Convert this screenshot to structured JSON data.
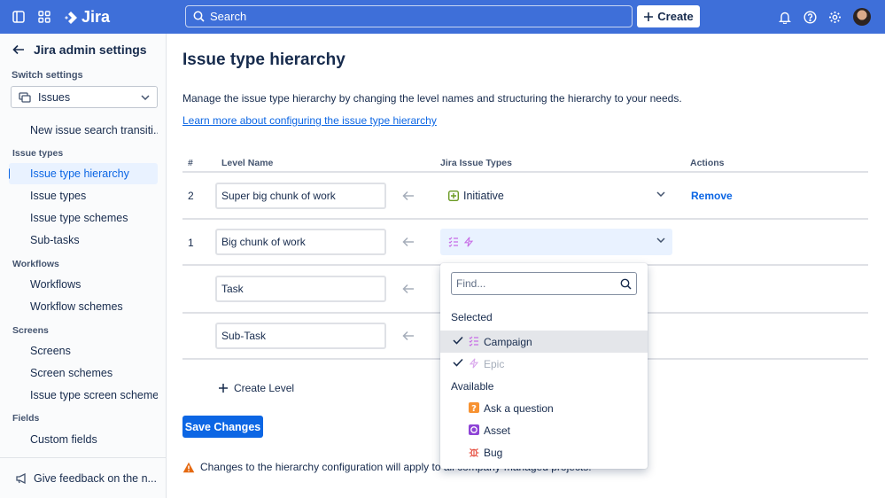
{
  "topnav": {
    "app_name": "Jira",
    "search_placeholder": "Search",
    "create_label": "Create"
  },
  "sidebar": {
    "title": "Jira admin settings",
    "switch_label": "Switch settings",
    "switch_value": "Issues",
    "items_top": [
      {
        "label": "New issue search transiti..."
      }
    ],
    "sections": [
      {
        "title": "Issue types",
        "items": [
          "Issue type hierarchy",
          "Issue types",
          "Issue type schemes",
          "Sub-tasks"
        ]
      },
      {
        "title": "Workflows",
        "items": [
          "Workflows",
          "Workflow schemes"
        ]
      },
      {
        "title": "Screens",
        "items": [
          "Screens",
          "Screen schemes",
          "Issue type screen schemes"
        ]
      },
      {
        "title": "Fields",
        "items": [
          "Custom fields"
        ]
      }
    ],
    "active_item": "Issue type hierarchy",
    "feedback_label": "Give feedback on the n..."
  },
  "main": {
    "title": "Issue type hierarchy",
    "description": "Manage the issue type hierarchy by changing the level names and structuring the hierarchy to your needs.",
    "learn_more": "Learn more about configuring the issue type hierarchy",
    "columns": {
      "num": "#",
      "level": "Level Name",
      "types": "Jira Issue Types",
      "actions": "Actions"
    },
    "rows": [
      {
        "num": "2",
        "level": "Super big chunk of work",
        "type": "Initiative",
        "action": "Remove"
      },
      {
        "num": "1",
        "level": "Big chunk of work",
        "type": "",
        "action": ""
      },
      {
        "num": "",
        "level": "Task",
        "type": "",
        "action": ""
      },
      {
        "num": "",
        "level": "Sub-Task",
        "type": "",
        "action": ""
      }
    ],
    "create_level": "Create Level",
    "save_label": "Save Changes",
    "warning": "Changes to the hierarchy configuration will apply to all company-managed projects."
  },
  "dropdown": {
    "find_placeholder": "Find...",
    "selected_label": "Selected",
    "selected": [
      {
        "label": "Campaign",
        "icon": "campaign-icon",
        "disabled": false
      },
      {
        "label": "Epic",
        "icon": "epic-icon",
        "disabled": true
      }
    ],
    "available_label": "Available",
    "available": [
      {
        "label": "Ask a question",
        "icon": "question-icon",
        "color": "#f79232"
      },
      {
        "label": "Asset",
        "icon": "asset-icon",
        "color": "#8e44d6"
      },
      {
        "label": "Bug",
        "icon": "bug-icon",
        "color": "#e5493a"
      }
    ]
  },
  "colors": {
    "nav": "#3e6fd9",
    "primary": "#0c66e4",
    "initiative": "#6a9a23",
    "epic": "#c86ce6"
  }
}
